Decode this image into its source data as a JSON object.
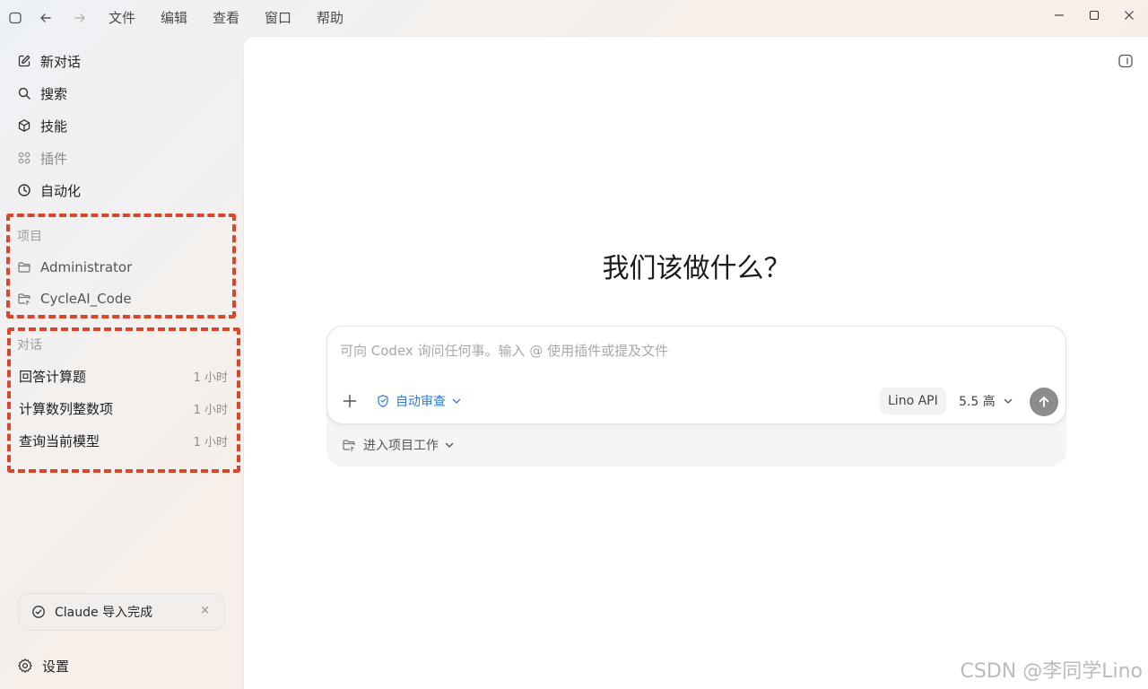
{
  "titlebar": {
    "menu": [
      "文件",
      "编辑",
      "查看",
      "窗口",
      "帮助"
    ],
    "icons": [
      "sidebar-toggle-icon",
      "back-arrow-icon",
      "forward-arrow-icon"
    ],
    "window_controls": [
      "minimize-icon",
      "maximize-icon",
      "close-icon"
    ]
  },
  "sidebar": {
    "nav": [
      {
        "label": "新对话",
        "icon": "edit-icon"
      },
      {
        "label": "搜索",
        "icon": "search-icon"
      },
      {
        "label": "技能",
        "icon": "cube-icon"
      },
      {
        "label": "插件",
        "icon": "grid-icon"
      },
      {
        "label": "自动化",
        "icon": "clock-icon"
      }
    ],
    "projects_title": "项目",
    "projects": [
      {
        "label": "Administrator",
        "icon": "folder-icon"
      },
      {
        "label": "CycleAI_Code",
        "icon": "folder-link-icon"
      }
    ],
    "conversations_title": "对话",
    "conversations": [
      {
        "title": "回答计算题",
        "time": "1 小时"
      },
      {
        "title": "计算数列整数项",
        "time": "1 小时"
      },
      {
        "title": "查询当前模型",
        "time": "1 小时"
      }
    ],
    "toast": {
      "text": "Claude 导入完成",
      "close": "×"
    },
    "settings_label": "设置"
  },
  "main": {
    "hero": "我们该做什么？",
    "composer": {
      "placeholder": "可向 Codex 询问任何事。输入 @ 使用插件或提及文件",
      "auto_review": "自动审查",
      "api_chip": "Lino API",
      "model": "5.5 高",
      "project_work": "进入项目工作"
    }
  },
  "watermark": "CSDN @李同学Lino",
  "colors": {
    "highlight_dash": "#d9472b",
    "accent_blue": "#2b7de0",
    "send_button": "#8c8c8c"
  }
}
